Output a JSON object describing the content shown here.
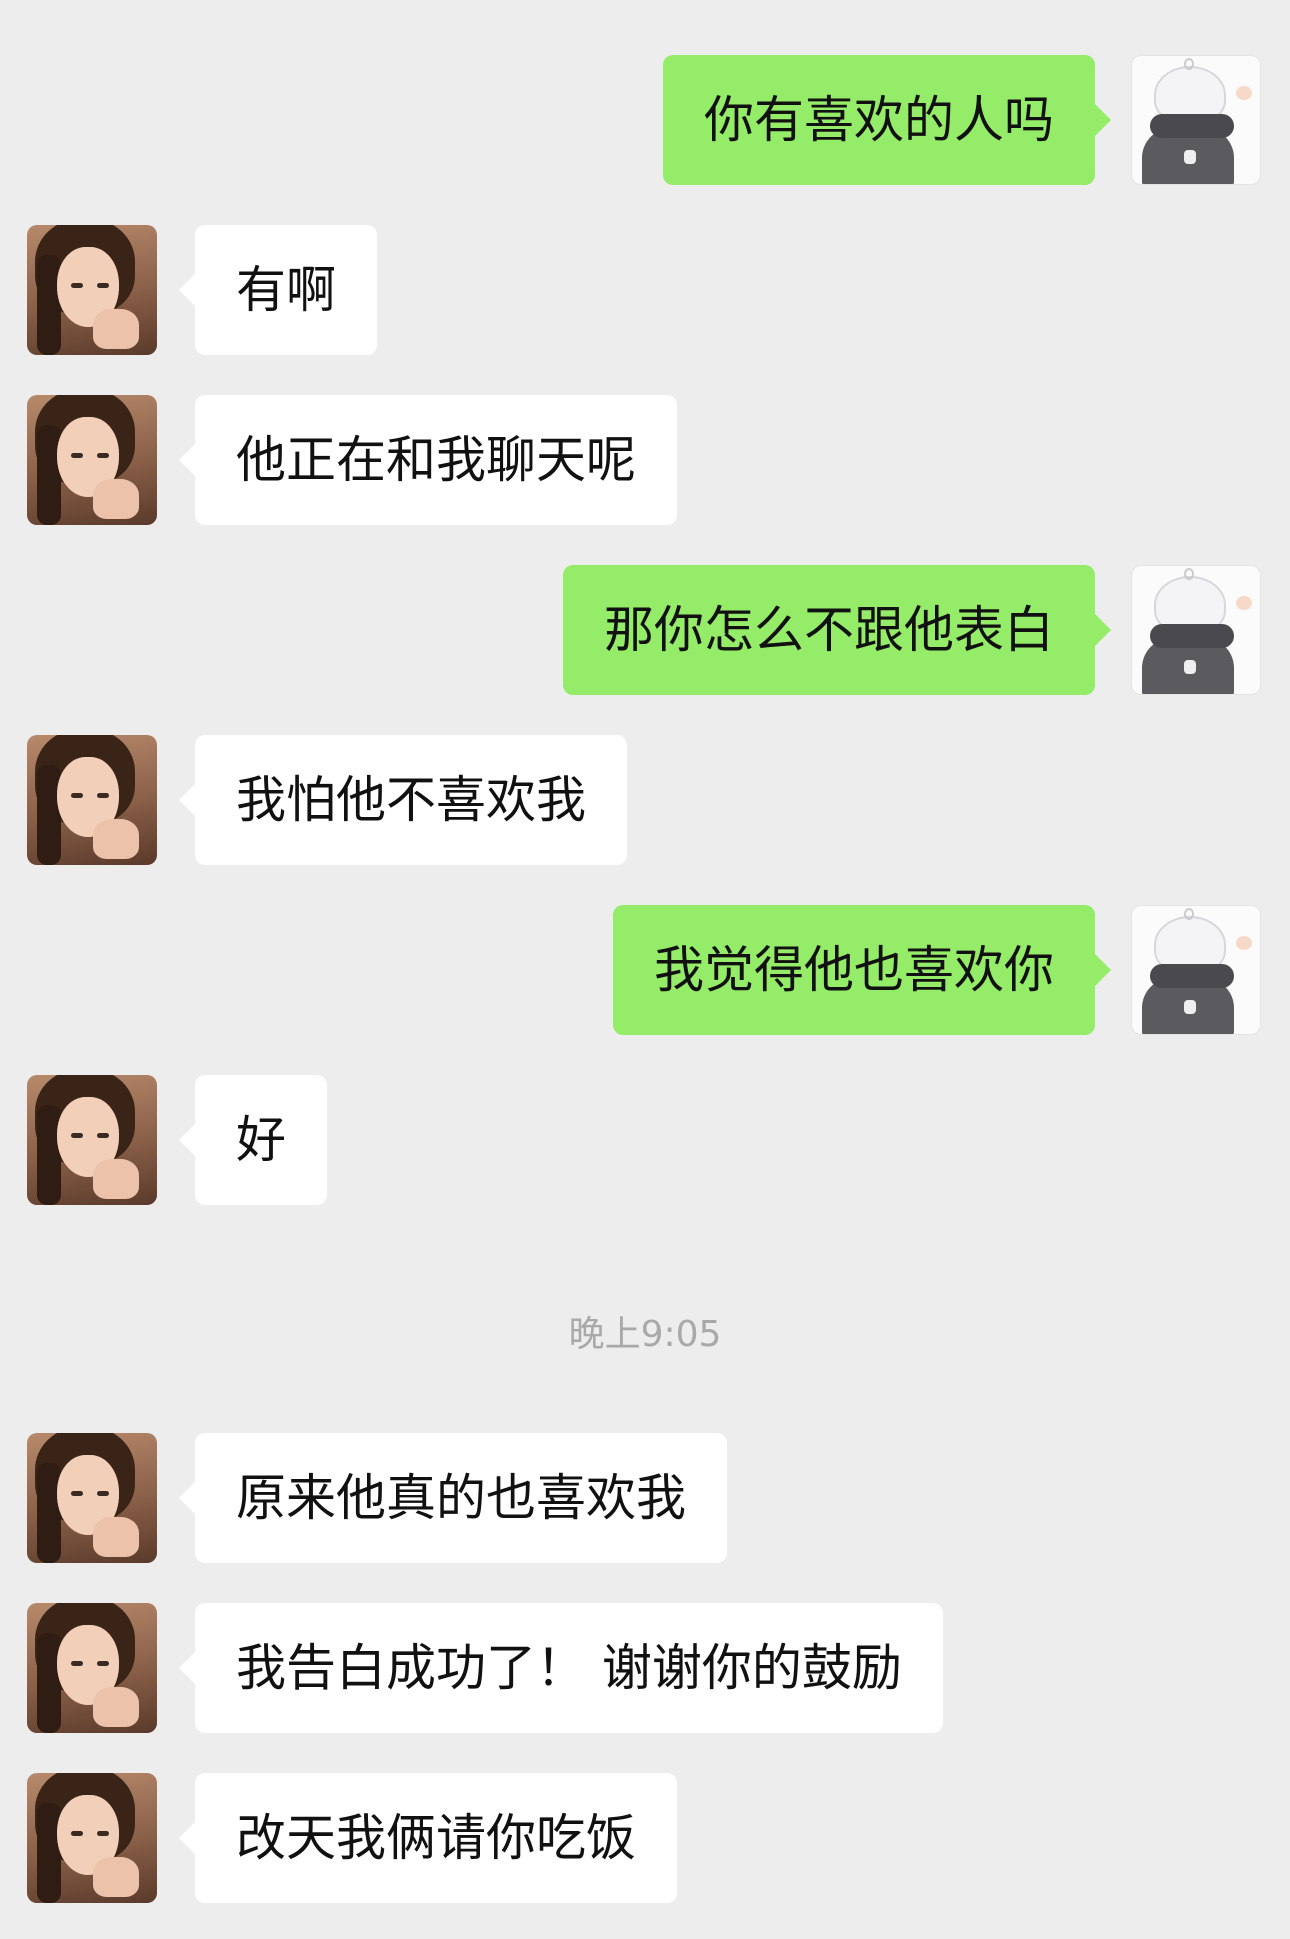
{
  "chat": {
    "timestamp": "晚上9:05",
    "messages": [
      {
        "sender": "me",
        "text": "你有喜欢的人吗"
      },
      {
        "sender": "her",
        "text": "有啊"
      },
      {
        "sender": "her",
        "text": "他正在和我聊天呢"
      },
      {
        "sender": "me",
        "text": "那你怎么不跟他表白"
      },
      {
        "sender": "her",
        "text": "我怕他不喜欢我"
      },
      {
        "sender": "me",
        "text": "我觉得他也喜欢你"
      },
      {
        "sender": "her",
        "text": "好"
      },
      {
        "sender": "her",
        "text": "原来他真的也喜欢我"
      },
      {
        "sender": "her",
        "text": "我告白成功了！ 谢谢你的鼓励"
      },
      {
        "sender": "her",
        "text": "改天我俩请你吃饭"
      }
    ]
  },
  "colors": {
    "background": "#ededed",
    "outgoing_bubble": "#95ec69",
    "incoming_bubble": "#ffffff",
    "timestamp_text": "#a9a9a9"
  },
  "icons": {
    "contact_avatar": "girl-photo-avatar",
    "my_avatar": "anime-boy-avatar"
  }
}
